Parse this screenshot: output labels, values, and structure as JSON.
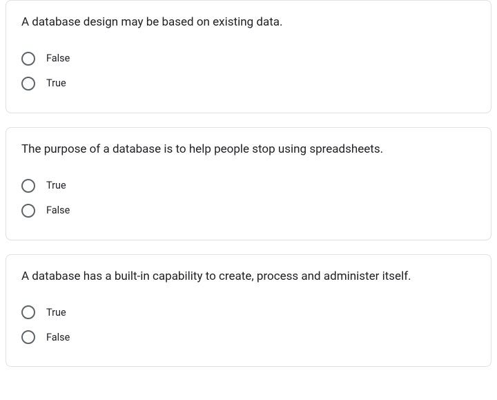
{
  "questions": [
    {
      "prompt": "A database design may be based on existing data.",
      "options": [
        "False",
        "True"
      ]
    },
    {
      "prompt": "The purpose of a database is to help people stop using spreadsheets.",
      "options": [
        "True",
        "False"
      ]
    },
    {
      "prompt": "A database has a built-in capability to create, process and administer itself.",
      "options": [
        "True",
        "False"
      ]
    }
  ]
}
